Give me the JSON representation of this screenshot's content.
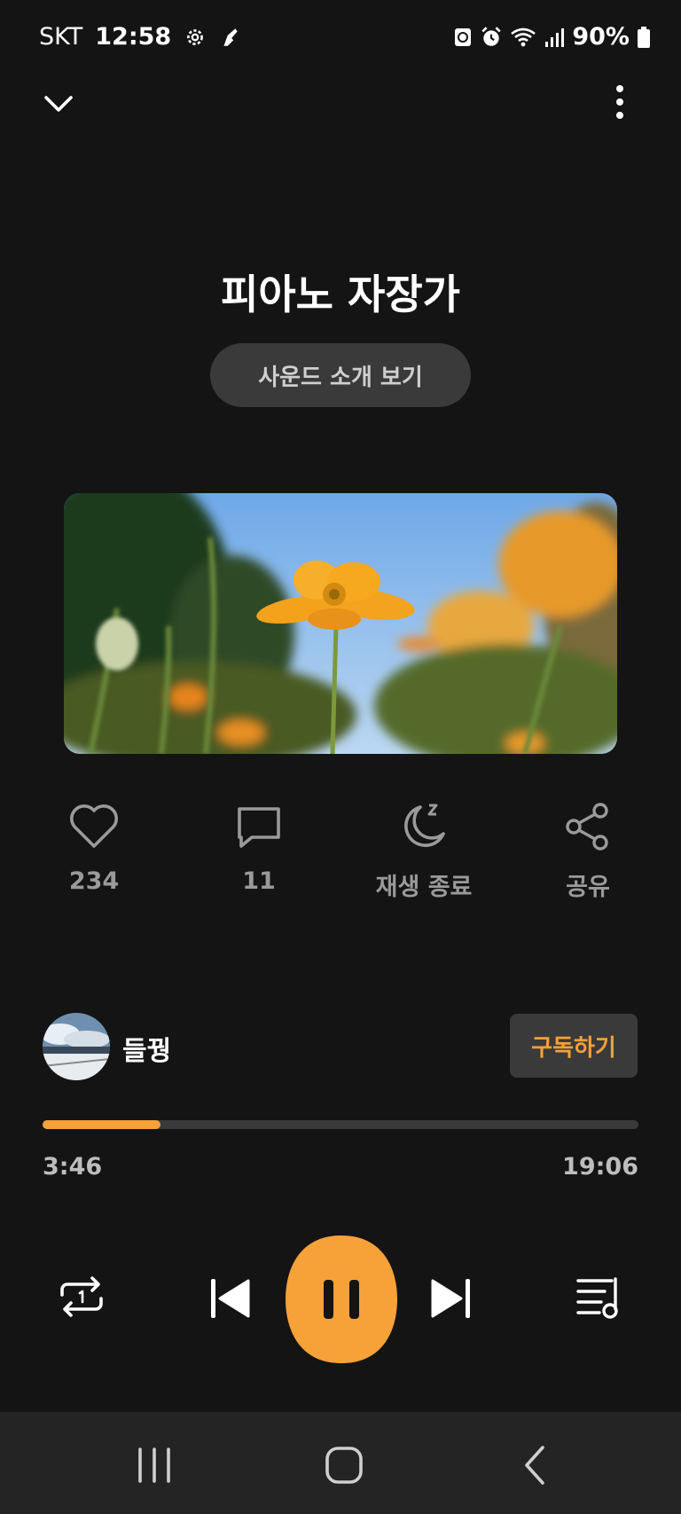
{
  "status_bar": {
    "carrier": "SKT",
    "time": "12:58",
    "battery": "90%"
  },
  "player": {
    "title": "피아노 자장가",
    "intro_button": "사운드 소개 보기"
  },
  "actions": {
    "like": {
      "label": "234",
      "icon": "heart-icon"
    },
    "comment": {
      "label": "11",
      "icon": "speech-bubble-icon"
    },
    "sleep_timer": {
      "label": "재생 종료",
      "icon": "moon-sleep-icon"
    },
    "share": {
      "label": "공유",
      "icon": "share-icon"
    }
  },
  "creator": {
    "name": "들꿩",
    "subscribe_label": "구독하기"
  },
  "progress": {
    "elapsed": "3:46",
    "total": "19:06",
    "fraction": 0.198
  },
  "colors": {
    "accent": "#f7a139",
    "background": "#141414",
    "button": "#3a3a3a"
  }
}
